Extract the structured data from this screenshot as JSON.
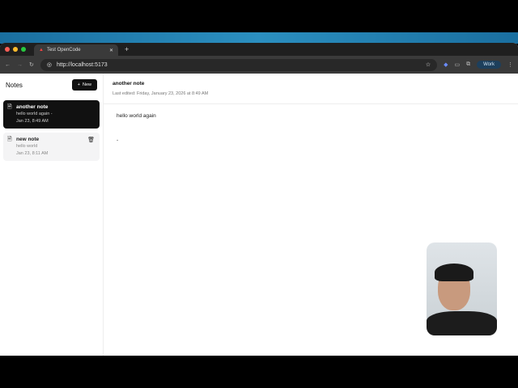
{
  "browser": {
    "tab_title": "Test OpenCode",
    "url": "http://localhost:5173",
    "profile": "Work"
  },
  "sidebar": {
    "title": "Notes",
    "new_label": "New",
    "notes": [
      {
        "title": "another note",
        "preview": "hello world again -",
        "date": "Jan 23, 8:49 AM"
      },
      {
        "title": "new note",
        "preview": "hello world",
        "date": "Jan 23, 8:11 AM"
      }
    ]
  },
  "editor": {
    "title": "another note",
    "last_edited": "Last edited: Friday, January 23, 2026 at 8:49 AM",
    "lines": [
      "hello world again",
      "-"
    ]
  }
}
